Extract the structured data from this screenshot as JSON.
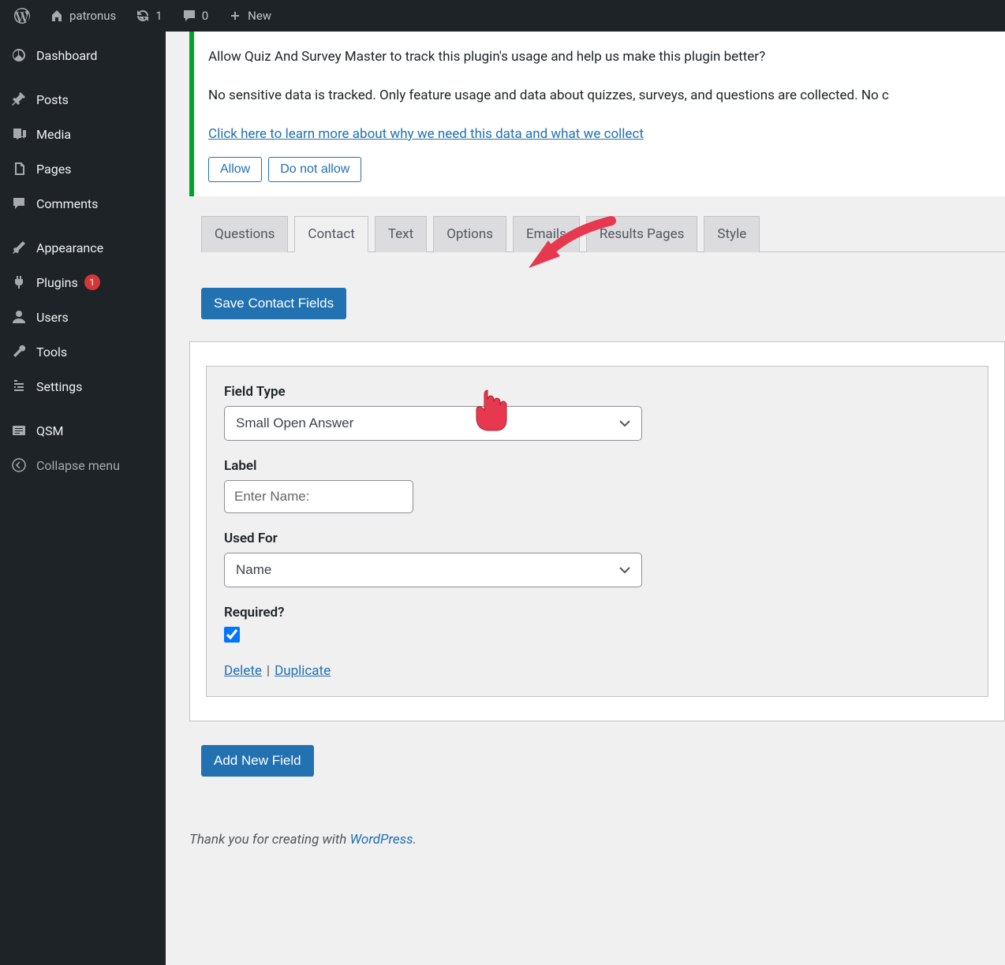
{
  "adminbar": {
    "site_name": "patronus",
    "updates_count": "1",
    "comments_count": "0",
    "new_label": "New"
  },
  "sidebar": {
    "items": [
      {
        "label": "Dashboard"
      },
      {
        "label": "Posts"
      },
      {
        "label": "Media"
      },
      {
        "label": "Pages"
      },
      {
        "label": "Comments"
      },
      {
        "label": "Appearance"
      },
      {
        "label": "Plugins",
        "badge": "1"
      },
      {
        "label": "Users"
      },
      {
        "label": "Tools"
      },
      {
        "label": "Settings"
      },
      {
        "label": "QSM"
      },
      {
        "label": "Collapse menu"
      }
    ]
  },
  "notice": {
    "line1": "Allow Quiz And Survey Master to track this plugin's usage and help us make this plugin better?",
    "line2": "No sensitive data is tracked. Only feature usage and data about quizzes, surveys, and questions are collected. No c",
    "link": "Click here to learn more about why we need this data and what we collect",
    "allow": "Allow",
    "deny": "Do not allow"
  },
  "tabs": [
    "Questions",
    "Contact",
    "Text",
    "Options",
    "Emails",
    "Results Pages",
    "Style"
  ],
  "active_tab": "Contact",
  "buttons": {
    "save": "Save Contact Fields",
    "add": "Add New Field"
  },
  "form": {
    "field_type_label": "Field Type",
    "field_type_value": "Small Open Answer",
    "label_label": "Label",
    "label_value": "Enter Name:",
    "used_for_label": "Used For",
    "used_for_value": "Name",
    "required_label": "Required?",
    "required_checked": true,
    "delete": "Delete",
    "duplicate": "Duplicate"
  },
  "footer": {
    "text": "Thank you for creating with ",
    "link": "WordPress"
  }
}
